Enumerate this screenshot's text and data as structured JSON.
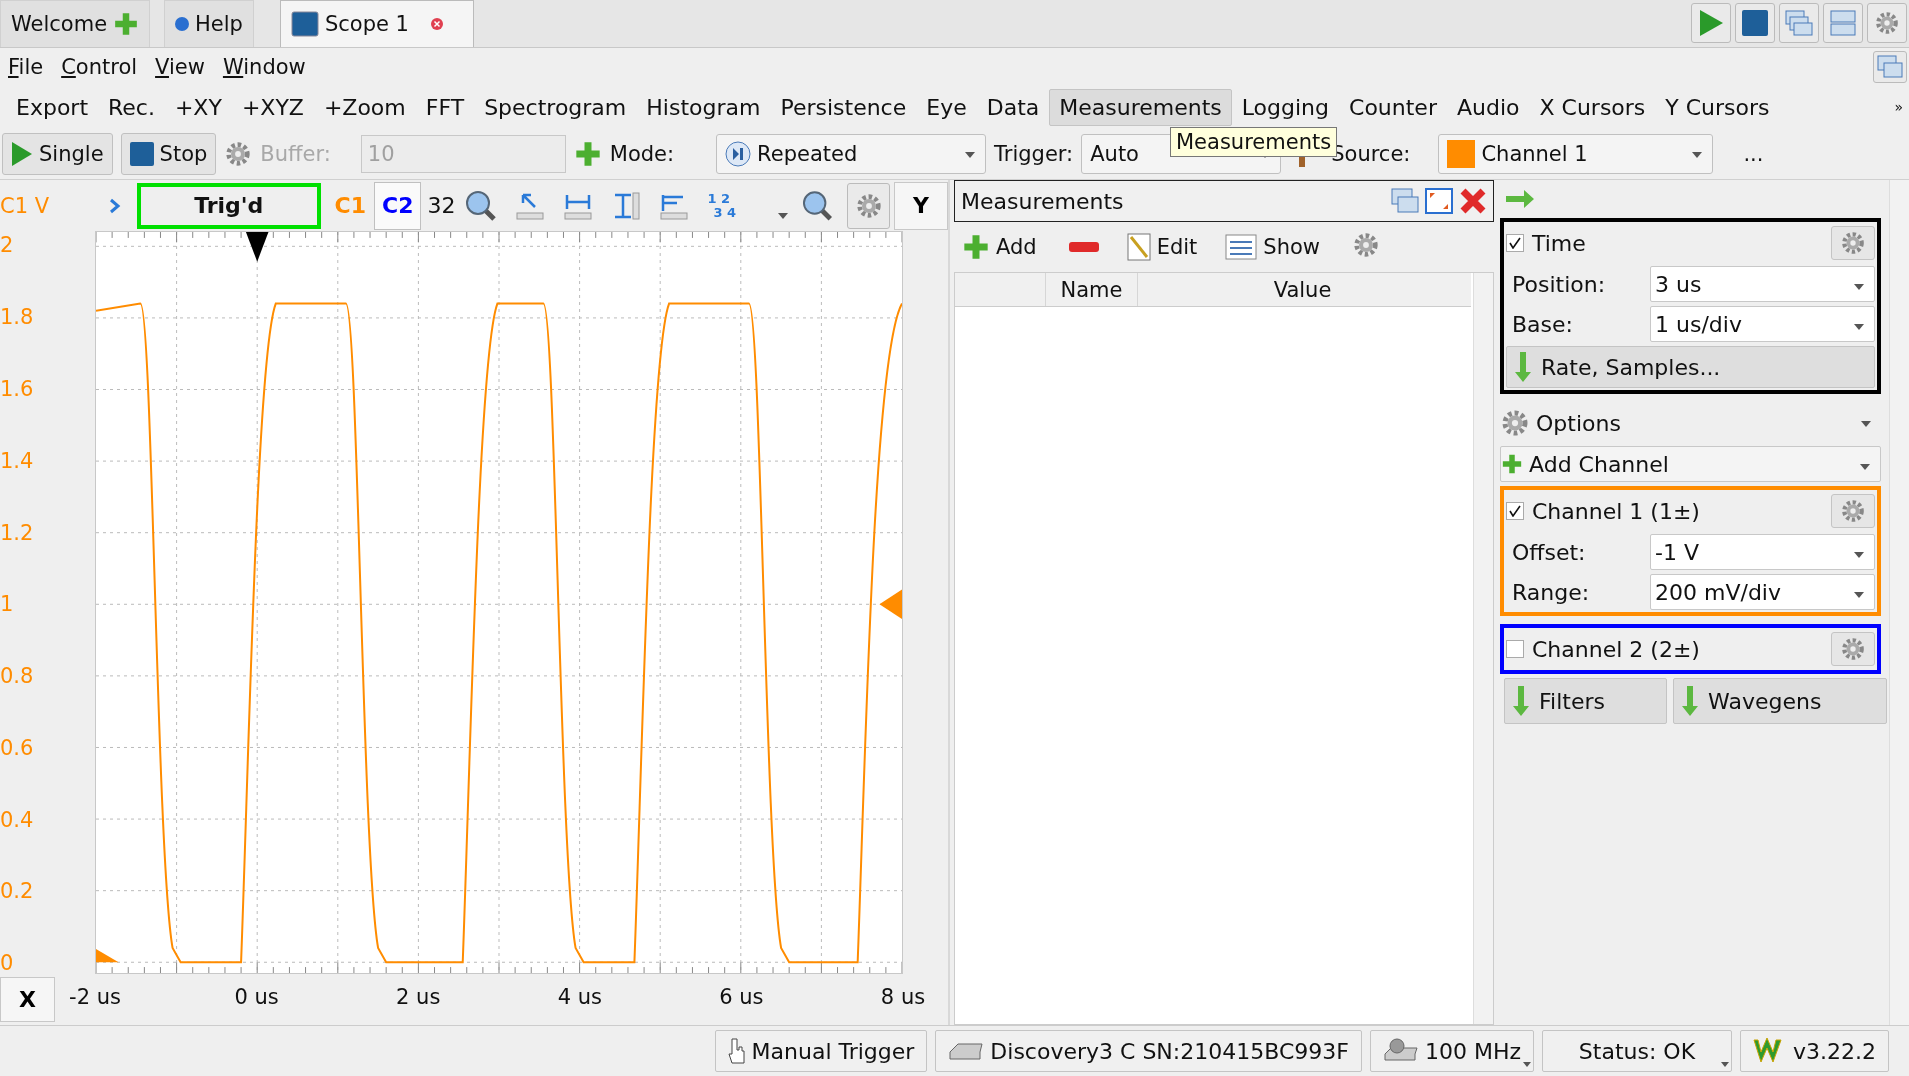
{
  "tabs": [
    {
      "label": "Welcome",
      "selected": false
    },
    {
      "label": "Help",
      "selected": false
    },
    {
      "label": "Scope 1",
      "selected": true
    }
  ],
  "menu": [
    "File",
    "Control",
    "View",
    "Window"
  ],
  "views": [
    {
      "label": "Export",
      "selected": false
    },
    {
      "label": "Rec.",
      "selected": false
    },
    {
      "label": "+XY",
      "selected": false
    },
    {
      "label": "+XYZ",
      "selected": false
    },
    {
      "label": "+Zoom",
      "selected": false
    },
    {
      "label": "FFT",
      "selected": false
    },
    {
      "label": "Spectrogram",
      "selected": false
    },
    {
      "label": "Histogram",
      "selected": false
    },
    {
      "label": "Persistence",
      "selected": false
    },
    {
      "label": "Eye",
      "selected": false
    },
    {
      "label": "Data",
      "selected": false
    },
    {
      "label": "Measurements",
      "selected": true
    },
    {
      "label": "Logging",
      "selected": false
    },
    {
      "label": "Counter",
      "selected": false
    },
    {
      "label": "Audio",
      "selected": false
    },
    {
      "label": "X Cursors",
      "selected": false
    },
    {
      "label": "Y Cursors",
      "selected": false
    }
  ],
  "overflow": "»",
  "tooltip": "Measurements",
  "toolbar": {
    "single": "Single",
    "stop": "Stop",
    "buffer_label": "Buffer:",
    "buffer_value": "10",
    "buffer_disabled": true,
    "mode_label": "Mode:",
    "mode": "Repeated",
    "trigger_label": "Trigger:",
    "trigger": "Auto",
    "source_label": "Source:",
    "source": "Channel 1",
    "more": "..."
  },
  "plot": {
    "unit_label": "C1 V",
    "status": "Trig'd",
    "channels": [
      {
        "label": "C1",
        "color": "#ff8c00",
        "selected": false
      },
      {
        "label": "C2",
        "color": "#0000ff",
        "selected": true
      }
    ],
    "count": "32",
    "digits": [
      "1 2",
      "3 4"
    ],
    "y_button": "Y",
    "x_button": "X",
    "y_ticks": [
      "2",
      "1.8",
      "1.6",
      "1.4",
      "1.2",
      "1",
      "0.8",
      "0.6",
      "0.4",
      "0.2",
      "0"
    ],
    "x_ticks": [
      "-2 us",
      "0 us",
      "2 us",
      "4 us",
      "6 us",
      "8 us"
    ]
  },
  "measurements": {
    "title": "Measurements",
    "add": "Add",
    "edit": "Edit",
    "show": "Show",
    "columns": [
      "Name",
      "Value"
    ]
  },
  "time": {
    "title": "Time",
    "checked": true,
    "fields": [
      {
        "label": "Position:",
        "value": "3 us"
      },
      {
        "label": "Base:",
        "value": "1 us/div"
      }
    ],
    "button": "Rate, Samples..."
  },
  "options": "Options",
  "add_channel": "Add Channel",
  "channels": [
    {
      "title": "Channel 1 (1±)",
      "checked": true,
      "color": "#ff8c00",
      "fields": [
        {
          "label": "Offset:",
          "value": "-1 V"
        },
        {
          "label": "Range:",
          "value": "200 mV/div"
        }
      ]
    },
    {
      "title": "Channel 2 (2±)",
      "checked": false,
      "color": "#0000ff"
    }
  ],
  "panel_buttons": [
    "Filters",
    "Wavegens"
  ],
  "status": [
    {
      "label": "Manual Trigger",
      "dropdown": false
    },
    {
      "label": "Discovery3 C SN:210415BC993F",
      "dropdown": false
    },
    {
      "label": "100 MHz",
      "dropdown": true
    },
    {
      "label": "Status: OK",
      "dropdown": true
    },
    {
      "label": "v3.22.2",
      "dropdown": false
    }
  ]
}
